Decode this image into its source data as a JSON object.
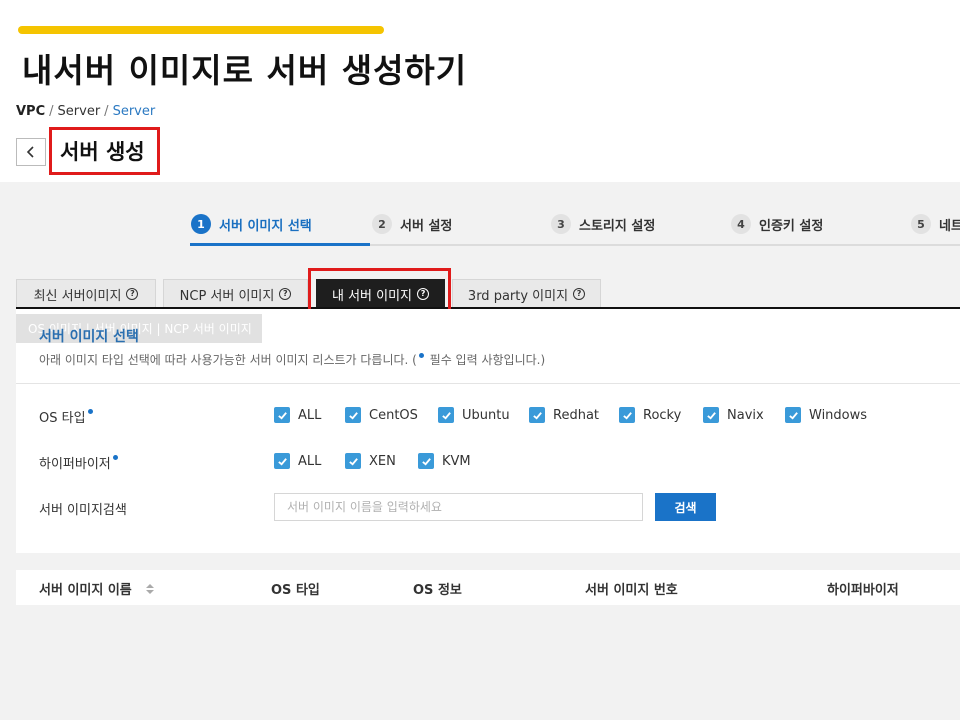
{
  "slide": {
    "title": "내서버 이미지로 서버 생성하기"
  },
  "breadcrumb": {
    "root": "VPC",
    "mid": "Server",
    "current": "Server",
    "sep": "/"
  },
  "page": {
    "title": "서버 생성"
  },
  "steps": [
    {
      "num": "1",
      "label": "서버 이미지 선택"
    },
    {
      "num": "2",
      "label": "서버 설정"
    },
    {
      "num": "3",
      "label": "스토리지 설정"
    },
    {
      "num": "4",
      "label": "인증키 설정"
    },
    {
      "num": "5",
      "label": "네트"
    }
  ],
  "tabs": [
    {
      "label": "최신 서버이미지"
    },
    {
      "label": "NCP 서버 이미지"
    },
    {
      "label": "내 서버 이미지"
    },
    {
      "label": "3rd party 이미지"
    }
  ],
  "ghost_tab": "OS 이미지 | 서버 이미지 | NCP 서버 이미지",
  "section": {
    "title": "서버 이미지 선택",
    "desc_prefix": "아래 이미지 타입 선택에 따라 사용가능한 서버 이미지 리스트가 다릅니다. (",
    "desc_suffix": " 필수 입력 사항입니다.)"
  },
  "form": {
    "os_label": "OS 타입",
    "os_options": [
      "ALL",
      "CentOS",
      "Ubuntu",
      "Redhat",
      "Rocky",
      "Navix",
      "Windows"
    ],
    "hv_label": "하이퍼바이저",
    "hv_options": [
      "ALL",
      "XEN",
      "KVM"
    ],
    "search_label": "서버 이미지검색",
    "search_placeholder": "서버 이미지 이름을 입력하세요",
    "search_button": "검색"
  },
  "table": {
    "headers": [
      "서버 이미지 이름",
      "OS 타입",
      "OS 정보",
      "서버 이미지 번호",
      "하이퍼바이저"
    ]
  },
  "colors": {
    "accent": "#1a73c8",
    "highlight": "#e01b1b",
    "title_bar": "#f5c400"
  }
}
